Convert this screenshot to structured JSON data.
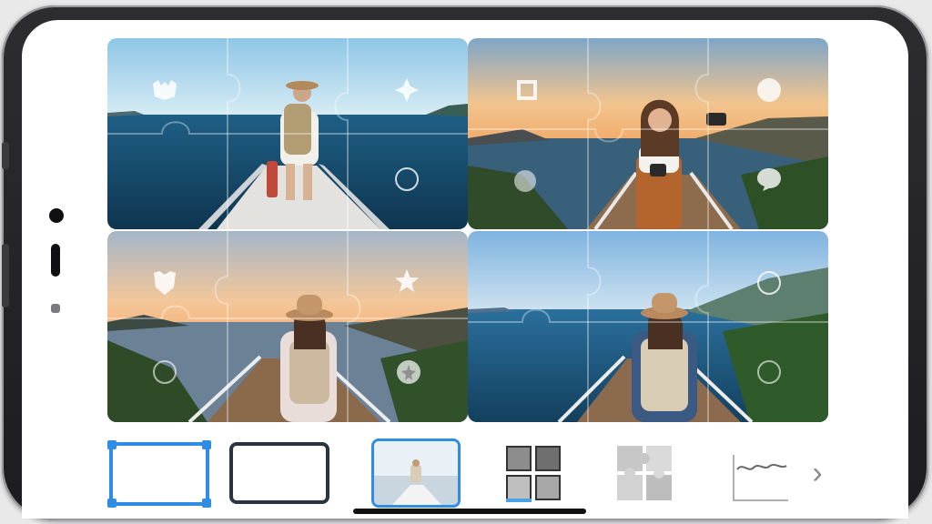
{
  "grid": {
    "photos": [
      {
        "scene": "woman-boat-ocean",
        "icons": [
          "bat-icon",
          "star-burst-icon",
          "circle-icon"
        ]
      },
      {
        "scene": "woman-camera-boardwalk",
        "icons": [
          "badge-icon",
          "circle-icon",
          "speech-bubble-icon"
        ]
      },
      {
        "scene": "woman-hat-boardwalk-sunset",
        "icons": [
          "shield-icon",
          "star-icon",
          "star-bubble-icon"
        ]
      },
      {
        "scene": "woman-hat-boardwalk-sea",
        "icons": [
          "circle-icon",
          "circle-icon"
        ]
      }
    ],
    "puzzle_overlay": true
  },
  "toolbar": {
    "tools": [
      {
        "name": "frame-blue-tool",
        "selected": true
      },
      {
        "name": "frame-dark-tool",
        "selected": false
      },
      {
        "name": "photo-thumbnail-tool",
        "selected": true
      },
      {
        "name": "grid-layout-tool",
        "selected": false
      },
      {
        "name": "puzzle-tool",
        "selected": false
      },
      {
        "name": "wave-frame-tool",
        "selected": false
      }
    ],
    "next_glyph": "›"
  },
  "colors": {
    "accent": "#2f8de4",
    "frame_dark": "#2b3440",
    "grid_blue": "#4aa3e8"
  }
}
